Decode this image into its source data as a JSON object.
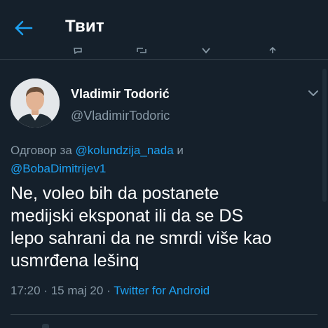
{
  "header": {
    "title": "Твит",
    "back_icon": "arrow-left-icon"
  },
  "colors": {
    "background": "#15202b",
    "accent": "#1da1f2",
    "secondary_text": "#8899a6",
    "primary_text": "#ffffff",
    "divider": "#38444d"
  },
  "tweet": {
    "author": {
      "display_name": "Vladimir Todorić",
      "handle": "@VladimirTodoric",
      "avatar_icon": "avatar"
    },
    "more_icon": "chevron-down-icon",
    "reply": {
      "prefix": "Одговор за",
      "mention1": "@kolundzija_nada",
      "joiner": "и",
      "mention2": "@BobaDimitrijev1"
    },
    "text_lines": [
      "Ne, voleo bih da postanete",
      "medijski eksponat ili da se DS",
      "lepo sahrani da ne smrdi više kao",
      "usmrđena lešinq"
    ],
    "meta": {
      "time": "17:20",
      "date": "15 maj 20",
      "separator": "·",
      "source": "Twitter for Android"
    }
  }
}
